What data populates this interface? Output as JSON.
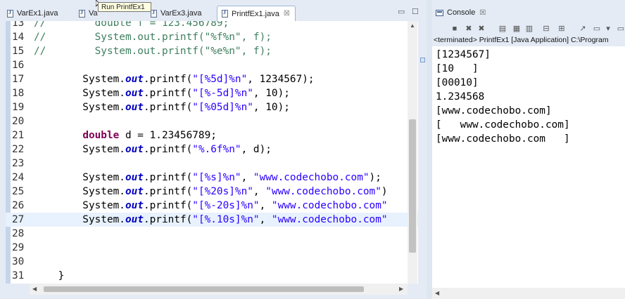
{
  "editor": {
    "tabs": [
      {
        "label": "VarEx1.java",
        "active": false
      },
      {
        "label": "Va",
        "active": false
      },
      {
        "label": "VarEx3.java",
        "active": false
      },
      {
        "label": "PrintfEx1.java",
        "active": true,
        "close": "☒"
      }
    ],
    "tooltip": "Run PrintfEx1",
    "window_buttons": {
      "minimize": "▭",
      "maximize": "☐"
    },
    "current_line": 27,
    "lines": [
      {
        "n": "13",
        "parts": [
          {
            "t": "cm",
            "v": "//        double f = 123.456789;"
          }
        ]
      },
      {
        "n": "14",
        "parts": [
          {
            "t": "cm",
            "v": "//        System.out.printf(\"%f%n\", f);"
          }
        ]
      },
      {
        "n": "15",
        "parts": [
          {
            "t": "cm",
            "v": "//        System.out.printf(\"%e%n\", f);"
          }
        ]
      },
      {
        "n": "16",
        "parts": []
      },
      {
        "n": "17",
        "parts": [
          {
            "t": "txt",
            "v": "        System."
          },
          {
            "t": "fld",
            "v": "out"
          },
          {
            "t": "txt",
            "v": ".printf("
          },
          {
            "t": "str",
            "v": "\"[%5d]%n\""
          },
          {
            "t": "txt",
            "v": ", 1234567);"
          }
        ]
      },
      {
        "n": "18",
        "parts": [
          {
            "t": "txt",
            "v": "        System."
          },
          {
            "t": "fld",
            "v": "out"
          },
          {
            "t": "txt",
            "v": ".printf("
          },
          {
            "t": "str",
            "v": "\"[%-5d]%n\""
          },
          {
            "t": "txt",
            "v": ", 10);"
          }
        ]
      },
      {
        "n": "19",
        "parts": [
          {
            "t": "txt",
            "v": "        System."
          },
          {
            "t": "fld",
            "v": "out"
          },
          {
            "t": "txt",
            "v": ".printf("
          },
          {
            "t": "str",
            "v": "\"[%05d]%n\""
          },
          {
            "t": "txt",
            "v": ", 10);"
          }
        ]
      },
      {
        "n": "20",
        "parts": []
      },
      {
        "n": "21",
        "parts": [
          {
            "t": "txt",
            "v": "        "
          },
          {
            "t": "kw",
            "v": "double"
          },
          {
            "t": "txt",
            "v": " d = 1.23456789;"
          }
        ]
      },
      {
        "n": "22",
        "parts": [
          {
            "t": "txt",
            "v": "        System."
          },
          {
            "t": "fld",
            "v": "out"
          },
          {
            "t": "txt",
            "v": ".printf("
          },
          {
            "t": "str",
            "v": "\"%.6f%n\""
          },
          {
            "t": "txt",
            "v": ", d);"
          }
        ]
      },
      {
        "n": "23",
        "parts": []
      },
      {
        "n": "24",
        "parts": [
          {
            "t": "txt",
            "v": "        System."
          },
          {
            "t": "fld",
            "v": "out"
          },
          {
            "t": "txt",
            "v": ".printf("
          },
          {
            "t": "str",
            "v": "\"[%s]%n\""
          },
          {
            "t": "txt",
            "v": ", "
          },
          {
            "t": "str",
            "v": "\"www.codechobo.com\""
          },
          {
            "t": "txt",
            "v": ");"
          }
        ]
      },
      {
        "n": "25",
        "parts": [
          {
            "t": "txt",
            "v": "        System."
          },
          {
            "t": "fld",
            "v": "out"
          },
          {
            "t": "txt",
            "v": ".printf("
          },
          {
            "t": "str",
            "v": "\"[%20s]%n\""
          },
          {
            "t": "txt",
            "v": ", "
          },
          {
            "t": "str",
            "v": "\"www.codechobo.com\""
          },
          {
            "t": "txt",
            "v": ")"
          }
        ]
      },
      {
        "n": "26",
        "parts": [
          {
            "t": "txt",
            "v": "        System."
          },
          {
            "t": "fld",
            "v": "out"
          },
          {
            "t": "txt",
            "v": ".printf("
          },
          {
            "t": "str",
            "v": "\"[%-20s]%n\""
          },
          {
            "t": "txt",
            "v": ", "
          },
          {
            "t": "str",
            "v": "\"www.codechobo.com\""
          },
          {
            "t": "txt",
            "v": ""
          }
        ]
      },
      {
        "n": "27",
        "parts": [
          {
            "t": "txt",
            "v": "        System."
          },
          {
            "t": "fld",
            "v": "out"
          },
          {
            "t": "txt",
            "v": ".printf("
          },
          {
            "t": "str",
            "v": "\"[%.10s]%n\""
          },
          {
            "t": "txt",
            "v": ", "
          },
          {
            "t": "str",
            "v": "\"www.codechobo.com\""
          },
          {
            "t": "txt",
            "v": ""
          }
        ]
      },
      {
        "n": "28",
        "parts": []
      },
      {
        "n": "29",
        "parts": []
      },
      {
        "n": "30",
        "parts": []
      },
      {
        "n": "31",
        "parts": [
          {
            "t": "txt",
            "v": "    }"
          }
        ]
      }
    ]
  },
  "console": {
    "tab_label": "Console",
    "tab_close": "☒",
    "toolbar_icons": [
      "■",
      "✖",
      "✖",
      "▤",
      "▦",
      "▥",
      "⊟",
      "⊞",
      "↗",
      "▭",
      "▾",
      "▭"
    ],
    "status": "<terminated> PrintfEx1 [Java Application] C:\\Program",
    "output": [
      "[1234567]",
      "[10   ]",
      "[00010]",
      "1.234568",
      "[www.codechobo.com]",
      "[   www.codechobo.com]",
      "[www.codechobo.com   ]"
    ]
  },
  "colors": {
    "comment": "#3f7f5f",
    "keyword": "#7f0055",
    "field": "#0000c0",
    "string": "#2a00ff",
    "current_line": "#e8f2fe"
  }
}
